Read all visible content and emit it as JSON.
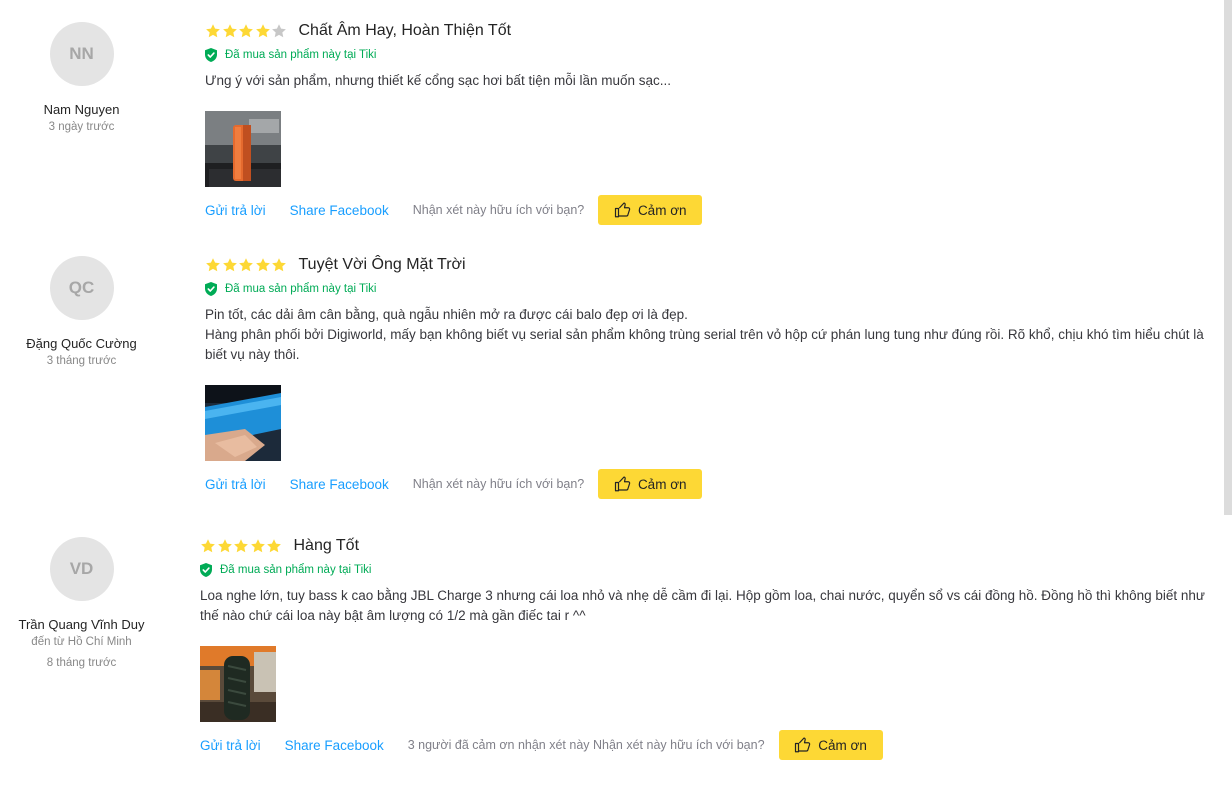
{
  "colors": {
    "star": "#fdd835",
    "star_empty": "#c7c7c7",
    "verified": "#00ab56",
    "link": "#189eff",
    "button": "#fdd835"
  },
  "reviews": [
    {
      "initials": "NN",
      "name": "Nam Nguyen",
      "location": "",
      "time": "3 ngày trước",
      "rating": 4,
      "title": "Chất Âm Hay, Hoàn Thiện Tốt",
      "verified": "Đã mua sản phẩm này tại Tiki",
      "comment": [
        "Ưng ý với sản phẩm, nhưng thiết kế cổng sạc hơi bất tiện mỗi lần muốn sạc..."
      ],
      "photo_icon": "orange-speaker-photo",
      "reply": "Gửi trả lời",
      "share": "Share Facebook",
      "helpful": "Nhận xét này hữu ích với bạn?",
      "thanks": "Cảm ơn"
    },
    {
      "initials": "QC",
      "name": "Đặng Quốc Cường",
      "location": "",
      "time": "3 tháng trước",
      "rating": 5,
      "title": "Tuyệt Vời Ông Mặt Trời",
      "verified": "Đã mua sản phẩm này tại Tiki",
      "comment": [
        "Pin tốt, các dải âm cân bằng, quà ngẫu nhiên mở ra được cái balo đẹp ơi là đẹp.",
        "Hàng phân phối bởi Digiworld, mấy bạn không biết vụ serial sản phẩm không trùng serial trên vỏ hộp cứ phán lung tung như đúng rồi. Rõ khổ, chịu khó tìm hiểu chút là biết vụ này thôi."
      ],
      "photo_icon": "blue-speaker-photo",
      "reply": "Gửi trả lời",
      "share": "Share Facebook",
      "helpful": "Nhận xét này hữu ích với bạn?",
      "thanks": "Cảm ơn"
    },
    {
      "initials": "VD",
      "name": "Trần Quang Vĩnh Duy",
      "location": "đến từ Hồ Chí Minh",
      "time": "8 tháng trước",
      "rating": 5,
      "title": "Hàng Tốt",
      "verified": "Đã mua sản phẩm này tại Tiki",
      "comment": [
        "Loa nghe lớn, tuy bass k cao bằng JBL Charge 3 nhưng cái loa nhỏ và nhẹ dễ cầm đi lại. Hộp gồm loa, chai nước, quyển sổ vs cái đồng hồ. Đồng hồ thì không biết như thế nào chứ cái loa này bật âm lượng có 1/2 mà gần điếc tai r ^^"
      ],
      "photo_icon": "black-speaker-photo",
      "reply": "Gửi trả lời",
      "share": "Share Facebook",
      "helpful": "3 người đã cảm ơn nhận xét này Nhận xét này hữu ích với bạn?",
      "thanks": "Cảm ơn"
    }
  ]
}
